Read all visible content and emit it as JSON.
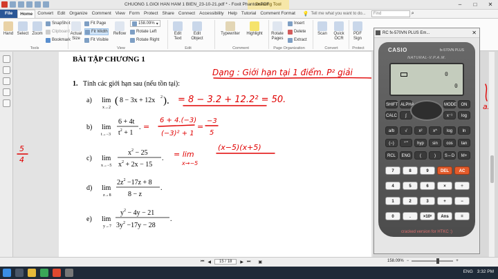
{
  "titlebar": {
    "tab_drawing": "Drawing Tool",
    "title": "CHUONG 1.GIOI HAN HAM 1 BIEN_23-10-21.pdf * - Foxit PhantomPDF",
    "tell_me": "Tell me what you want to do...",
    "search_placeholder": "Find"
  },
  "menu": [
    "File",
    "Home",
    "Convert",
    "Edit",
    "Organize",
    "Comment",
    "View",
    "Form",
    "Protect",
    "Share",
    "Connect",
    "Accessibility",
    "Help",
    "Tutorial",
    "Comment Format"
  ],
  "ribbon": {
    "hand": "Hand",
    "select": "Select",
    "zoom": "Zoom",
    "snapshot": "SnapShot",
    "clipboard": "Clipboard",
    "bookmark": "Bookmark",
    "tools_group": "Tools",
    "actual_size_1": "Actual",
    "actual_size_2": "Size",
    "fit_page": "Fit Page",
    "fit_width": "Fit Width",
    "fit_visible": "Fit Visible",
    "reflow": "Reflow",
    "zoom_value": "158.09%",
    "rotate_left": "Rotate Left",
    "rotate_right": "Rotate Right",
    "view_group": "View",
    "edit_text_1": "Edit",
    "edit_text_2": "Text",
    "edit_object_1": "Edit",
    "edit_object_2": "Object",
    "edit_group": "Edit",
    "typewriter": "Typewriter",
    "highlight": "Highlight",
    "comment_group": "Comment",
    "rotate_pages_1": "Rotate",
    "rotate_pages_2": "Pages",
    "insert": "Insert",
    "delete": "Delete",
    "extract": "Extract",
    "page_org_group": "Page Organization",
    "scan": "Scan",
    "quick_ocr_1": "Quick",
    "quick_ocr_2": "OCR",
    "pdf_sign_1": "PDF",
    "pdf_sign_2": "Sign",
    "convert_group": "Convert",
    "protect_group": "Protect"
  },
  "document": {
    "heading": "BÀI TẬP CHƯƠNG 1",
    "problem_number": "1.",
    "problem_text": "Tính các giới hạn sau (nếu tồn tại):",
    "items": [
      {
        "label": "a)"
      },
      {
        "label": "b)"
      },
      {
        "label": "c)"
      },
      {
        "label": "d)"
      },
      {
        "label": "e)"
      }
    ],
    "math": {
      "lim": "lim",
      "a_sub": "x→2",
      "a_open": "(",
      "a_body": "8 − 3x + 12x",
      "a_sq": "2",
      "a_close": ").",
      "b_sub": "t→−3",
      "b_num": "6 + 4t",
      "b_den_main": "t",
      "b_den_sq": "2",
      "b_den_tail": " + 1",
      "b_dot": ".",
      "c_sub": "x→−5",
      "c_num_main": "x",
      "c_num_sq": "2",
      "c_num_tail": " − 25",
      "c_den_main": "x",
      "c_den_sq": "2",
      "c_den_tail": " + 2x − 15",
      "c_dot": ".",
      "d_sub": "z→8",
      "d_num_a": "2z",
      "d_num_sq": "2",
      "d_num_tail": " −17z + 8",
      "d_den": "8 − z",
      "d_dot": ".",
      "e_sub": "y→7",
      "e_num_a": "y",
      "e_num_sq": "2",
      "e_num_tail": " − 4y − 21",
      "e_den_a": "3y",
      "e_den_sq": "2",
      "e_den_tail": " −17y − 28",
      "e_dot": "."
    }
  },
  "handwriting": {
    "dang": "Dạng : Giới hạn tại 1 điểm. P² giải",
    "a_work": "= 8 − 3.2 + 12.2² = 50.",
    "b_work_num": "6 + 4.(−3)",
    "b_work_den": "(−3)² + 1",
    "b_result_num": "−3",
    "b_result_den": "5",
    "c_work": "= lim",
    "c_work_sub": "x→−5",
    "c_factor": "(x−5)(x+5)",
    "margin_num": "5",
    "margin_den": "4",
    "side_note": "ax"
  },
  "calculator": {
    "window_title": "RC fx-570VN PLUS Em...",
    "brand": "CASIO",
    "model": "fx-570VN PLUS",
    "natural": "NATURAL-V.P.A.M.",
    "lcd_zero": "0",
    "lcd_zero2": "0",
    "cracked": "cracked version for HTKC :)",
    "keys_row1": [
      "SHIFT",
      "ALPHA",
      "",
      "",
      "MODE",
      "ON"
    ],
    "keys_row2": [
      "CALC",
      "∫",
      "",
      "",
      "x⁻¹",
      "log"
    ],
    "keys_row3": [
      "a/b",
      "√",
      "x²",
      "x^",
      "log",
      "ln"
    ],
    "keys_row4": [
      "(−)",
      "°'\"",
      "hyp",
      "sin",
      "cos",
      "tan"
    ],
    "keys_row5": [
      "RCL",
      "ENG",
      "(",
      ")",
      "S⇔D",
      "M+"
    ],
    "keys_num": [
      [
        "7",
        "8",
        "9",
        "DEL",
        "AC"
      ],
      [
        "4",
        "5",
        "6",
        "×",
        "÷"
      ],
      [
        "1",
        "2",
        "3",
        "+",
        "−"
      ],
      [
        "0",
        ".",
        "×10ˣ",
        "Ans",
        "="
      ]
    ]
  },
  "statusbar": {
    "page": "15 / 18",
    "zoom": "158.09%"
  },
  "taskbar": {
    "time": "3:32 PM",
    "lang": "ENG"
  },
  "colors": {
    "ink": "#e00000",
    "file_tab": "#2b5797",
    "calc_orange": "#e35b2b"
  }
}
